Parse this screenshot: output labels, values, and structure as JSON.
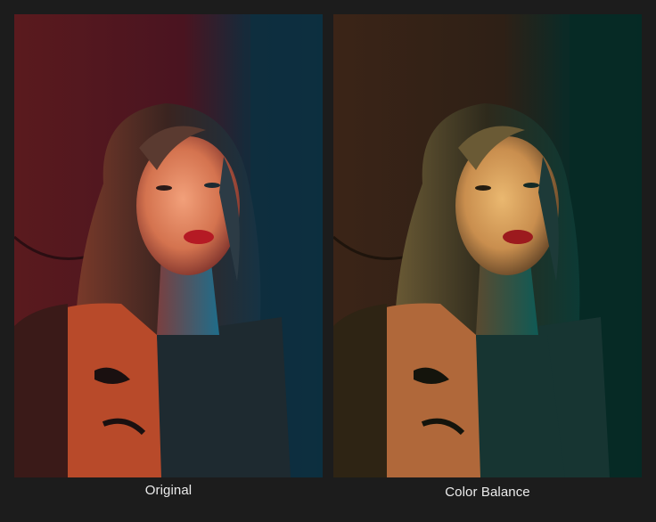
{
  "comparison": {
    "left": {
      "label": "Original",
      "colors": {
        "wall": "#5a1a1e",
        "shadow": "#0d2f3f",
        "cyan_light": "#1f6d8a",
        "hair": "#5a3a30",
        "face": "#e08a6a",
        "lips": "#b51a24",
        "jacket": "#b84a2a",
        "dress": "#1e2a30"
      }
    },
    "right": {
      "label": "Color Balance",
      "colors": {
        "wall": "#3b2417",
        "shadow": "#062a26",
        "cyan_light": "#0f5a55",
        "hair": "#6a5a35",
        "face": "#d5a260",
        "lips": "#9c1a1e",
        "jacket": "#b0683a",
        "dress": "#173532"
      }
    }
  }
}
